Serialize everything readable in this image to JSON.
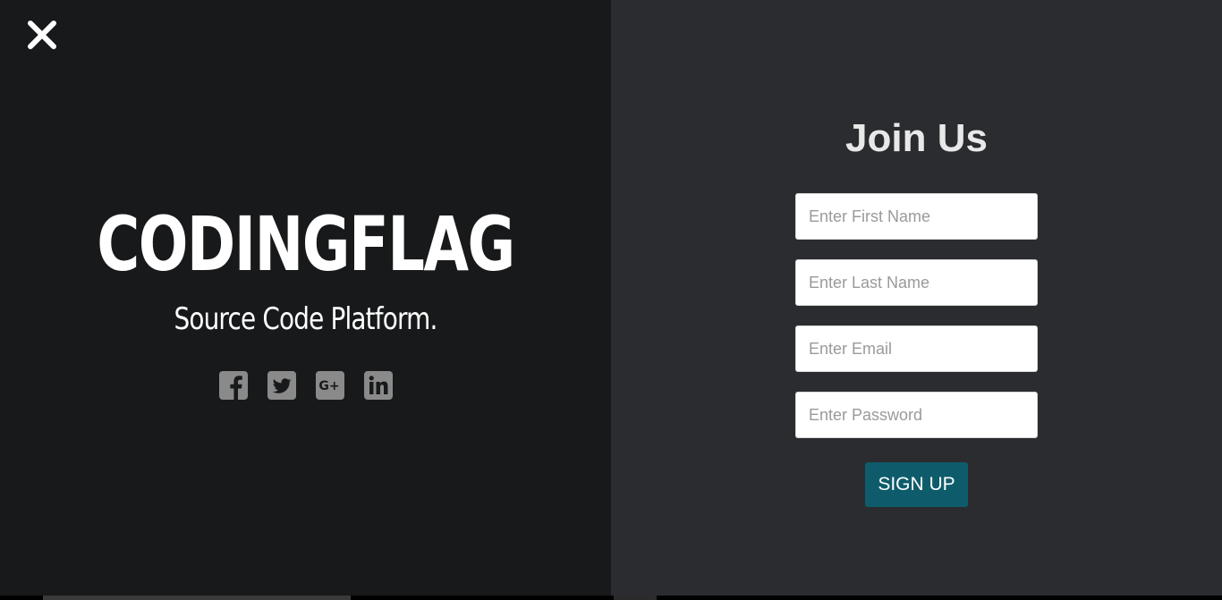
{
  "left": {
    "brand_title": "CODINGFLAG",
    "brand_subtitle": "Source Code Platform.",
    "close_icon": "close-icon",
    "socials": [
      {
        "name": "facebook-icon"
      },
      {
        "name": "twitter-icon"
      },
      {
        "name": "google-plus-icon"
      },
      {
        "name": "linkedin-icon"
      }
    ]
  },
  "form": {
    "title": "Join Us",
    "first_name_placeholder": "Enter First Name",
    "last_name_placeholder": "Enter Last Name",
    "email_placeholder": "Enter Email",
    "password_placeholder": "Enter Password",
    "submit_label": "SIGN UP"
  },
  "colors": {
    "left_background": "#18191b",
    "right_background": "#2a2c30",
    "button_background": "#0e5c6b",
    "social_icon": "#8a8a8a"
  }
}
